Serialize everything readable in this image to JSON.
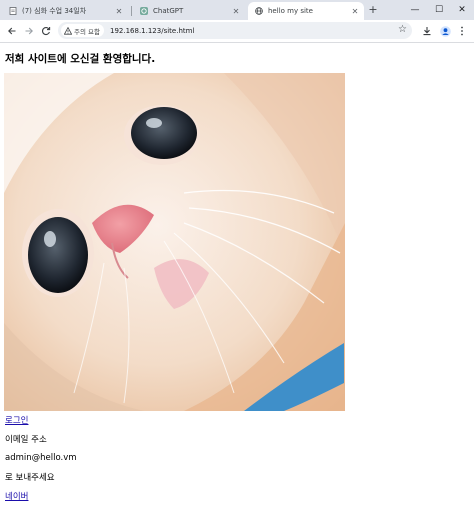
{
  "browser": {
    "tabs": [
      {
        "title": "(7) 심화 수업 34일차",
        "active": false
      },
      {
        "title": "ChatGPT",
        "active": false
      },
      {
        "title": "hello my site",
        "active": true
      }
    ],
    "new_tab_label": "+",
    "window_controls": {
      "minimize": "—",
      "maximize": "☐",
      "close": "✕"
    },
    "security_label": "주의 요함",
    "url": "192.168.1.123/site.html"
  },
  "page": {
    "heading": "저희 사이트에 오신걸 환영합니다.",
    "login_link": "로그인",
    "email_label": "이메일 주소",
    "email_value": "admin@hello.vm",
    "email_suffix": "로 보내주세요",
    "naver_link": "네이버"
  },
  "colors": {
    "tabstrip": "#dfe3eb",
    "link": "#1a0dab",
    "omnibox": "#edf0f4"
  },
  "icons": {
    "tab1": "document-icon",
    "tab2": "chatgpt-icon",
    "tab3": "globe-icon"
  }
}
